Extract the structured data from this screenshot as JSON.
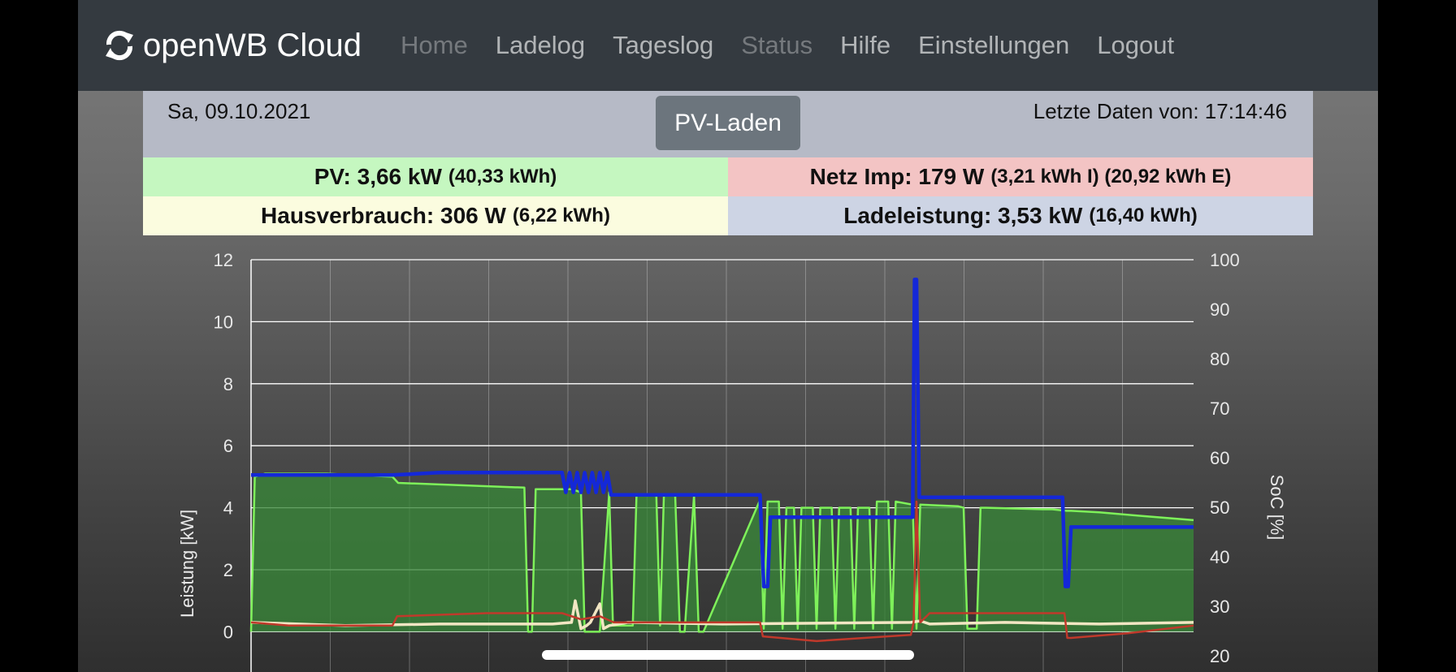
{
  "nav": {
    "brand": "openWB Cloud",
    "items": [
      {
        "label": "Home",
        "disabled": true
      },
      {
        "label": "Ladelog",
        "disabled": false
      },
      {
        "label": "Tageslog",
        "disabled": false
      },
      {
        "label": "Status",
        "disabled": true
      },
      {
        "label": "Hilfe",
        "disabled": false
      },
      {
        "label": "Einstellungen",
        "disabled": false
      },
      {
        "label": "Logout",
        "disabled": false
      }
    ]
  },
  "header": {
    "date": "Sa, 09.10.2021",
    "mode_button": "PV-Laden",
    "last_data": "Letzte Daten von: 17:14:46"
  },
  "tiles": {
    "pv": {
      "main": "PV: 3,66 kW",
      "sub": "(40,33 kWh)",
      "color": "#c5f7c0"
    },
    "grid": {
      "main": "Netz Imp: 179 W",
      "sub": "(3,21 kWh I) (20,92 kWh E)",
      "color": "#f3c4c4"
    },
    "house": {
      "main": "Hausverbrauch: 306 W",
      "sub": "(6,22 kWh)",
      "color": "#fbfcdf"
    },
    "charge": {
      "main": "Ladeleistung: 3,53 kW",
      "sub": "(16,40 kWh)",
      "color": "#cdd4e4"
    }
  },
  "chart_data": {
    "type": "line",
    "ylabel": "Leistung [kW]",
    "y2label": "SoC [%]",
    "ylim": [
      0,
      12
    ],
    "y_ticks": [
      0,
      2,
      4,
      6,
      8,
      10,
      12
    ],
    "y2lim": [
      20,
      100
    ],
    "y2_ticks": [
      20,
      30,
      40,
      50,
      60,
      70,
      80,
      90,
      100
    ],
    "x_range": [
      0,
      100
    ],
    "grid": true,
    "series": [
      {
        "key": "pv",
        "color": "#7ef15a",
        "fill": "rgba(56,135,56,0.78)",
        "x": [
          0,
          0.4,
          1.5,
          8,
          15,
          15.6,
          29,
          29.4,
          29.8,
          30.2,
          33,
          34,
          35,
          35.4,
          37,
          38,
          38.4,
          40.5,
          40.9,
          41.3,
          43,
          43.4,
          43.8,
          45,
          45.5,
          46,
          47,
          47.5,
          48,
          54,
          54.4,
          54.8,
          56,
          56.4,
          56.8,
          57.6,
          58,
          58.4,
          59.6,
          60,
          60.4,
          61.6,
          62,
          62.4,
          63.6,
          64,
          64.4,
          65.6,
          66,
          66.4,
          67.6,
          68,
          68.4,
          70.2,
          70.6,
          71,
          75,
          75.6,
          76,
          77,
          77.4,
          78,
          84,
          85,
          86.5,
          87,
          90,
          94,
          100
        ],
        "y": [
          0,
          5.0,
          5.1,
          5.1,
          5.0,
          4.8,
          4.65,
          0,
          0,
          4.6,
          4.6,
          4.6,
          4.5,
          0,
          0,
          4.5,
          0.2,
          0.2,
          4.4,
          4.4,
          4.4,
          0.2,
          4.4,
          4.4,
          0,
          0,
          4.4,
          0,
          0,
          4.25,
          0.1,
          4.2,
          4.2,
          0.1,
          4.0,
          4.0,
          0.1,
          4.0,
          4.0,
          0.1,
          4.0,
          4.0,
          0.1,
          4.0,
          4.0,
          0.1,
          4.0,
          4.0,
          0.1,
          4.2,
          4.2,
          0.1,
          4.2,
          4.1,
          0.1,
          4.1,
          4.05,
          4.0,
          0.1,
          0.1,
          4.0,
          4.0,
          3.95,
          3.95,
          3.9,
          3.9,
          3.85,
          3.75,
          3.6
        ]
      },
      {
        "key": "house",
        "color": "#f2e6c3",
        "x": [
          0,
          10,
          20,
          32,
          34,
          34.4,
          35,
          35.6,
          36,
          37,
          37.4,
          38,
          40,
          50,
          70,
          71,
          72,
          80,
          90,
          100
        ],
        "y": [
          0.3,
          0.2,
          0.25,
          0.25,
          0.3,
          1.0,
          0.1,
          0.2,
          0.3,
          0.9,
          0.1,
          0.2,
          0.3,
          0.25,
          0.3,
          0.35,
          0.25,
          0.3,
          0.25,
          0.3
        ]
      },
      {
        "key": "grid",
        "color": "#c0392b",
        "x": [
          0,
          4,
          15,
          15.5,
          25,
          33,
          35,
          37,
          38.5,
          54,
          54.3,
          60,
          70,
          70.3,
          70.6,
          71,
          72,
          86.3,
          86.6,
          87,
          93,
          100
        ],
        "y": [
          0.3,
          0.2,
          0.2,
          0.5,
          0.6,
          0.6,
          0.4,
          0.5,
          0.3,
          0.3,
          -0.15,
          -0.3,
          -0.1,
          0.3,
          4.2,
          0.3,
          0.6,
          0.6,
          -0.2,
          -0.2,
          -0.05,
          0.2
        ]
      },
      {
        "key": "soc",
        "color": "#1428d8",
        "x": [
          0,
          5,
          15,
          20,
          32,
          33,
          33.4,
          33.8,
          34.2,
          34.6,
          35,
          35.4,
          35.8,
          36.2,
          36.6,
          37,
          37.4,
          37.8,
          38.2,
          38.6,
          40,
          54,
          54.4,
          54.8,
          55.1,
          60,
          70.2,
          70.4,
          70.6,
          70.9,
          71.2,
          80,
          86.1,
          86.4,
          86.7,
          87,
          90,
          100
        ],
        "y": [
          56.5,
          56.5,
          56.5,
          57,
          57,
          57,
          53,
          57,
          53,
          57,
          53,
          57,
          53,
          57,
          53,
          57,
          53,
          57,
          52.5,
          52.5,
          52.5,
          52.5,
          34,
          34,
          48,
          48,
          48,
          96,
          96,
          52,
          52,
          52,
          52,
          34,
          34,
          46,
          46,
          46
        ]
      }
    ]
  }
}
